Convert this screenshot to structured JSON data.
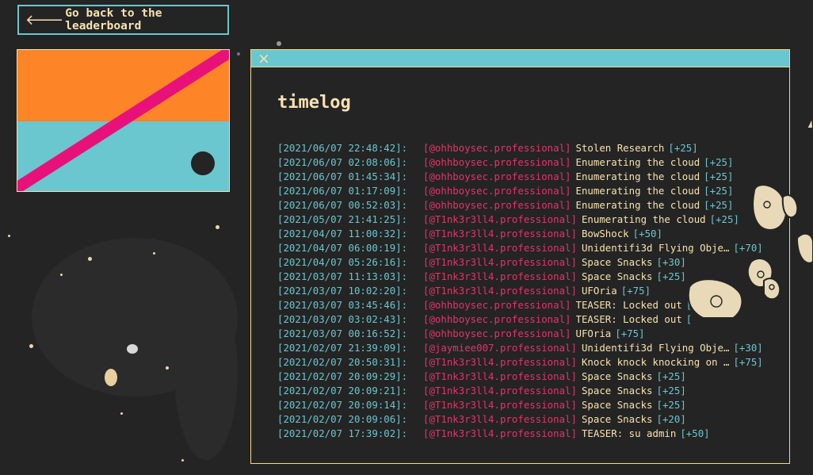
{
  "back_button": {
    "label": "Go back to the leaderboard"
  },
  "window": {
    "title": "timelog",
    "close_symbol": "×"
  },
  "log": [
    {
      "time": "[2021/06/07 22:48:42]:",
      "user": "[@ohhboysec.professional]",
      "challenge": "Stolen Research",
      "points": "[+25]"
    },
    {
      "time": "[2021/06/07 02:08:06]:",
      "user": "[@ohhboysec.professional]",
      "challenge": "Enumerating the cloud",
      "points": "[+25]"
    },
    {
      "time": "[2021/06/07 01:45:34]:",
      "user": "[@ohhboysec.professional]",
      "challenge": "Enumerating the cloud",
      "points": "[+25]"
    },
    {
      "time": "[2021/06/07 01:17:09]:",
      "user": "[@ohhboysec.professional]",
      "challenge": "Enumerating the cloud",
      "points": "[+25]"
    },
    {
      "time": "[2021/06/07 00:52:03]:",
      "user": "[@ohhboysec.professional]",
      "challenge": "Enumerating the cloud",
      "points": "[+25]"
    },
    {
      "time": "[2021/05/07 21:41:25]:",
      "user": "[@T1nk3r3ll4.professional]",
      "challenge": "Enumerating the cloud",
      "points": "[+25]"
    },
    {
      "time": "[2021/04/07 11:00:32]:",
      "user": "[@T1nk3r3ll4.professional]",
      "challenge": "BowShock",
      "points": "[+50]"
    },
    {
      "time": "[2021/04/07 06:00:19]:",
      "user": "[@T1nk3r3ll4.professional]",
      "challenge": "Unidentifi3d Flying Obje…",
      "points": "[+70]"
    },
    {
      "time": "[2021/04/07 05:26:16]:",
      "user": "[@T1nk3r3ll4.professional]",
      "challenge": "Space Snacks",
      "points": "[+30]"
    },
    {
      "time": "[2021/03/07 11:13:03]:",
      "user": "[@T1nk3r3ll4.professional]",
      "challenge": "Space Snacks",
      "points": "[+25]"
    },
    {
      "time": "[2021/03/07 10:02:20]:",
      "user": "[@T1nk3r3ll4.professional]",
      "challenge": "UFOria",
      "points": "[+75]"
    },
    {
      "time": "[2021/03/07 03:45:46]:",
      "user": "[@ohhboysec.professional]",
      "challenge": "TEASER: Locked out",
      "points": "["
    },
    {
      "time": "[2021/03/07 03:02:43]:",
      "user": "[@ohhboysec.professional]",
      "challenge": "TEASER: Locked out",
      "points": "["
    },
    {
      "time": "[2021/03/07 00:16:52]:",
      "user": "[@ohhboysec.professional]",
      "challenge": "UFOria",
      "points": "[+75]"
    },
    {
      "time": "[2021/02/07 21:39:09]:",
      "user": "[@jaymiee007.professional]",
      "challenge": "Unidentifi3d Flying Obje…",
      "points": "[+30]"
    },
    {
      "time": "[2021/02/07 20:50:31]:",
      "user": "[@T1nk3r3ll4.professional]",
      "challenge": "Knock knock knocking on …",
      "points": "[+75]"
    },
    {
      "time": "[2021/02/07 20:09:29]:",
      "user": "[@T1nk3r3ll4.professional]",
      "challenge": "Space Snacks",
      "points": "[+25]"
    },
    {
      "time": "[2021/02/07 20:09:21]:",
      "user": "[@T1nk3r3ll4.professional]",
      "challenge": "Space Snacks",
      "points": "[+25]"
    },
    {
      "time": "[2021/02/07 20:09:14]:",
      "user": "[@T1nk3r3ll4.professional]",
      "challenge": "Space Snacks",
      "points": "[+25]"
    },
    {
      "time": "[2021/02/07 20:09:06]:",
      "user": "[@T1nk3r3ll4.professional]",
      "challenge": "Space Snacks",
      "points": "[+20]"
    },
    {
      "time": "[2021/02/07 17:39:02]:",
      "user": "[@T1nk3r3ll4.professional]",
      "challenge": "TEASER: su admin",
      "points": "[+50]"
    }
  ],
  "colors": {
    "background": "#242424",
    "teal": "#6ac6cf",
    "cream": "#f7e2b0",
    "pink": "#e8316c",
    "orange": "#fd8427"
  },
  "icons": {
    "back": "arrow-left-icon",
    "close": "close-icon"
  }
}
